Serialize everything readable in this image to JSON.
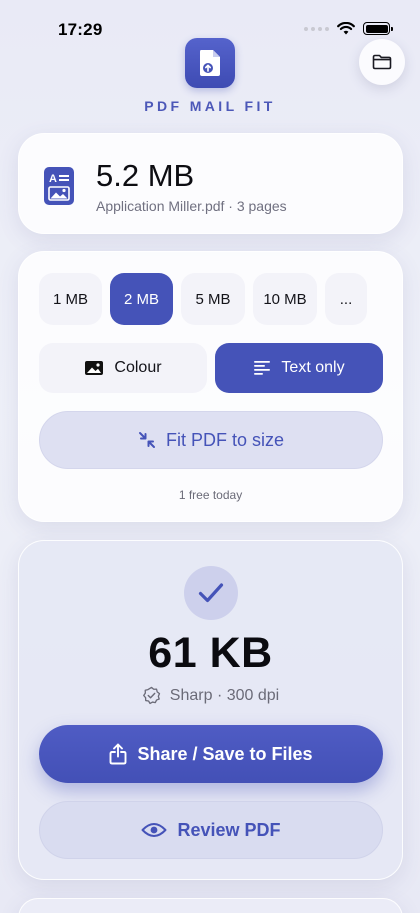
{
  "status_bar": {
    "time": "17:29"
  },
  "header": {
    "app_name": "PDF MAIL FIT"
  },
  "file": {
    "size": "5.2 MB",
    "meta": "Application Miller.pdf · 3 pages"
  },
  "size_options": [
    {
      "label": "1 MB",
      "selected": false
    },
    {
      "label": "2 MB",
      "selected": true
    },
    {
      "label": "5 MB",
      "selected": false
    },
    {
      "label": "10 MB",
      "selected": false
    },
    {
      "label": "...",
      "selected": false
    }
  ],
  "mode_options": [
    {
      "label": "Colour",
      "icon": "image-icon",
      "selected": false
    },
    {
      "label": "Text only",
      "icon": "text-lines-icon",
      "selected": true
    }
  ],
  "fit_button": {
    "label": "Fit PDF to size",
    "icon": "compress-arrows-icon"
  },
  "free_note": "1 free today",
  "result": {
    "size": "61 KB",
    "quality": "Sharp · 300 dpi",
    "share_label": "Share / Save to Files",
    "review_label": "Review PDF"
  },
  "colors": {
    "accent": "#4553B8",
    "accent_light": "#DEE0F2",
    "background": "#ECEDF7"
  }
}
